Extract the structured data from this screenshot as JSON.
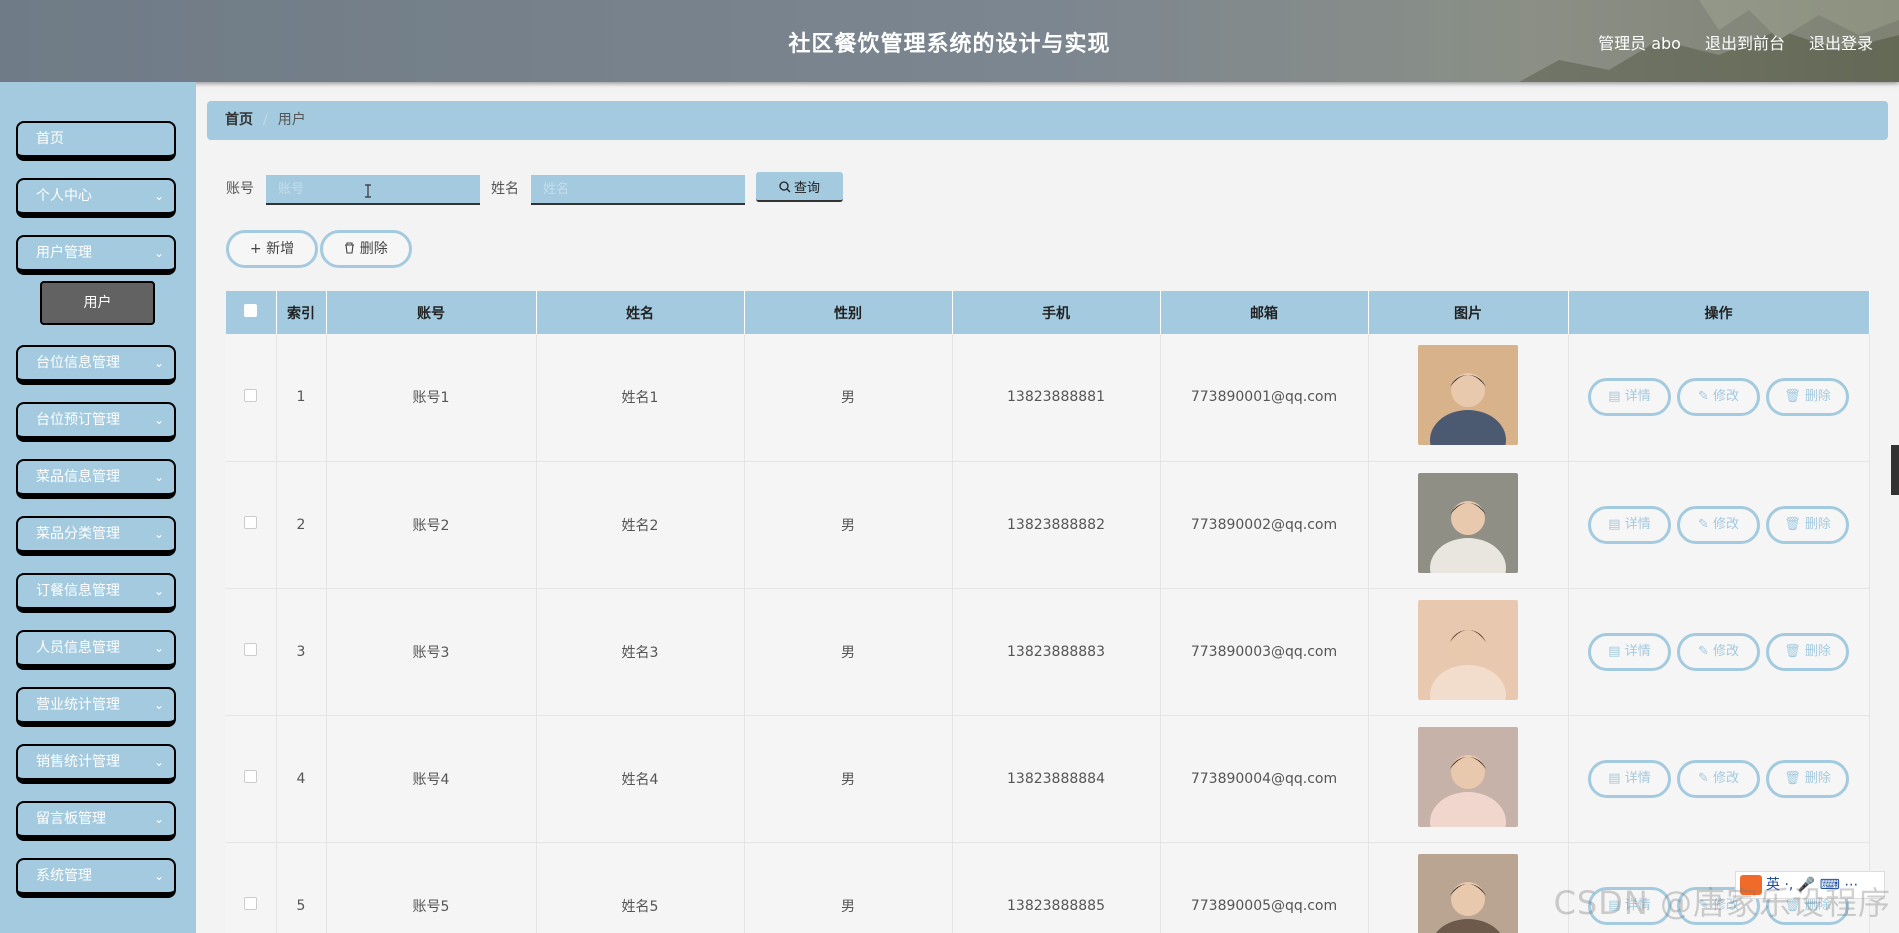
{
  "header": {
    "title": "社区餐饮管理系统的设计与实现",
    "user": "管理员 abo",
    "to_front": "退出到前台",
    "logout": "退出登录"
  },
  "sidebar": {
    "items": [
      {
        "label": "首页",
        "expandable": false
      },
      {
        "label": "个人中心",
        "expandable": true
      },
      {
        "label": "用户管理",
        "expandable": true
      },
      {
        "label": "台位信息管理",
        "expandable": true
      },
      {
        "label": "台位预订管理",
        "expandable": true
      },
      {
        "label": "菜品信息管理",
        "expandable": true
      },
      {
        "label": "菜品分类管理",
        "expandable": true
      },
      {
        "label": "订餐信息管理",
        "expandable": true
      },
      {
        "label": "人员信息管理",
        "expandable": true
      },
      {
        "label": "营业统计管理",
        "expandable": true
      },
      {
        "label": "销售统计管理",
        "expandable": true
      },
      {
        "label": "留言板管理",
        "expandable": true
      },
      {
        "label": "系统管理",
        "expandable": true
      }
    ],
    "sub_item": "用户"
  },
  "breadcrumb": {
    "home": "首页",
    "current": "用户"
  },
  "search": {
    "account_label": "账号",
    "account_placeholder": "账号",
    "name_label": "姓名",
    "name_placeholder": "姓名",
    "query_button": "查询"
  },
  "actions": {
    "add": "新增",
    "delete": "删除"
  },
  "table": {
    "headers": [
      "索引",
      "账号",
      "姓名",
      "性别",
      "手机",
      "邮箱",
      "图片",
      "操作"
    ],
    "row_actions": {
      "detail": "详情",
      "edit": "修改",
      "delete": "删除"
    },
    "rows": [
      {
        "index": "1",
        "account": "账号1",
        "name": "姓名1",
        "gender": "男",
        "phone": "13823888881",
        "email": "773890001@qq.com"
      },
      {
        "index": "2",
        "account": "账号2",
        "name": "姓名2",
        "gender": "男",
        "phone": "13823888882",
        "email": "773890002@qq.com"
      },
      {
        "index": "3",
        "account": "账号3",
        "name": "姓名3",
        "gender": "男",
        "phone": "13823888883",
        "email": "773890003@qq.com"
      },
      {
        "index": "4",
        "account": "账号4",
        "name": "姓名4",
        "gender": "男",
        "phone": "13823888884",
        "email": "773890004@qq.com"
      },
      {
        "index": "5",
        "account": "账号5",
        "name": "姓名5",
        "gender": "男",
        "phone": "13823888885",
        "email": "773890005@qq.com"
      }
    ]
  },
  "ime": {
    "text": "英 ·, 🎤 ⌨ ⋯"
  },
  "watermark": "CSDN @唐家乐设程序",
  "colors": {
    "accent": "#a3cadf",
    "header": "#7a8590",
    "sub_active": "#626262"
  }
}
